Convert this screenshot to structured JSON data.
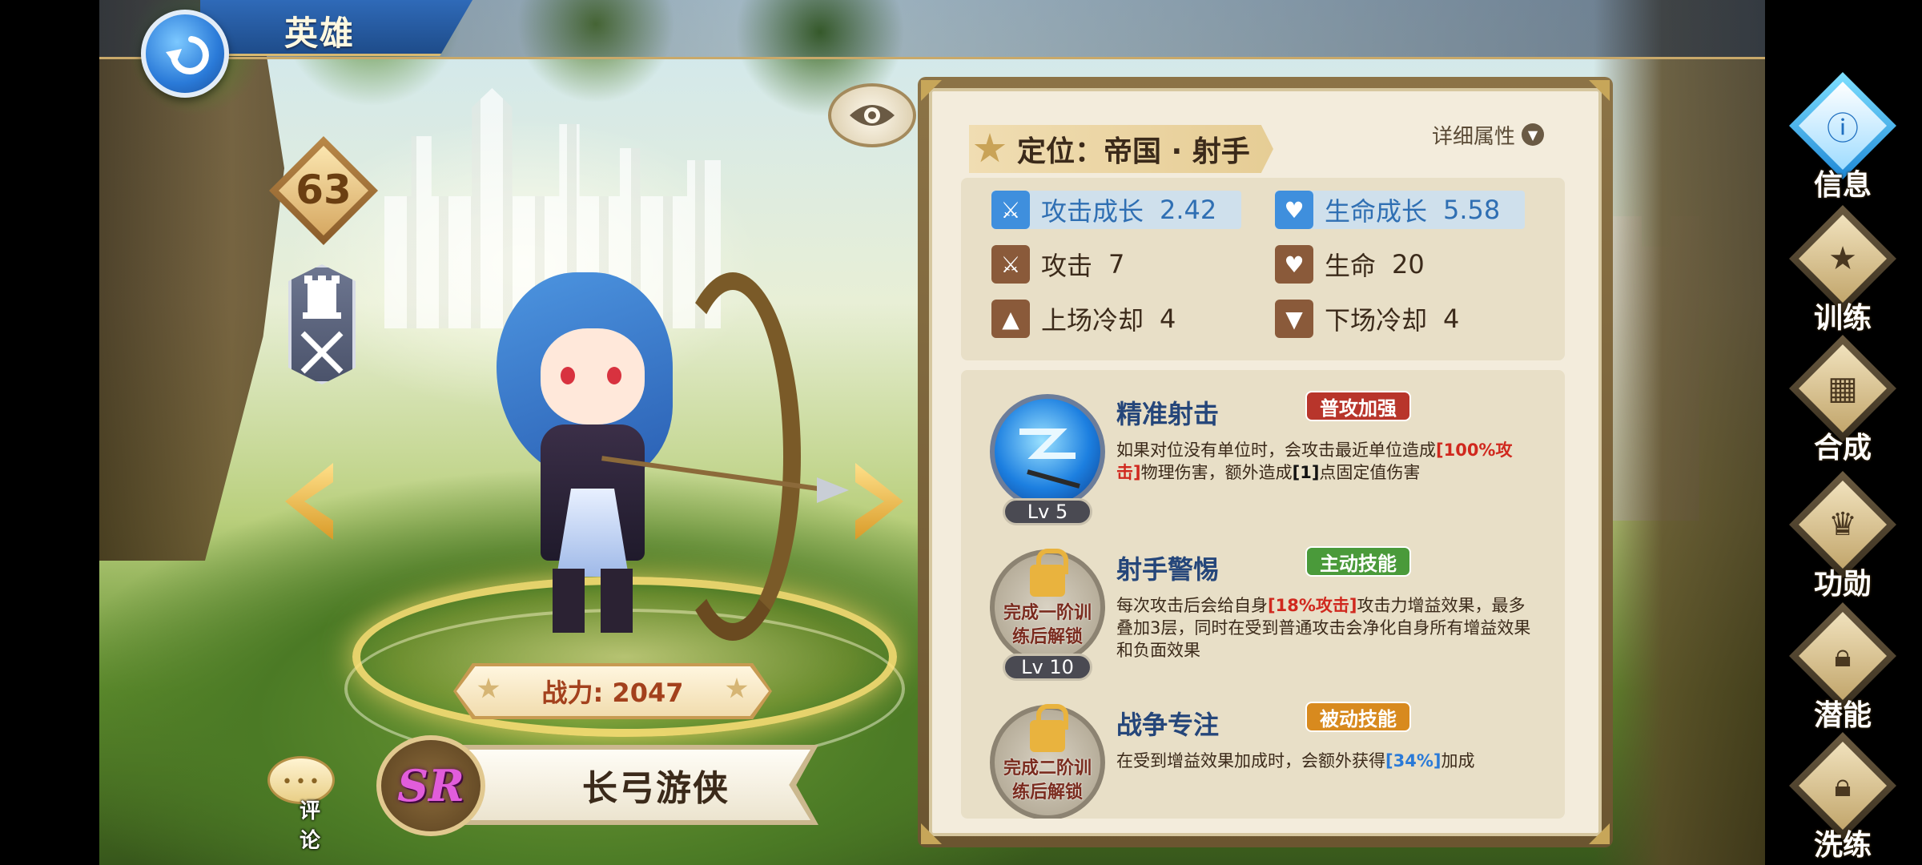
{
  "header": {
    "title": "英雄"
  },
  "hero": {
    "level": "63",
    "power": "战力: 2047",
    "rarity": "SR",
    "name": "长弓游侠",
    "comment_label": "评论"
  },
  "panel": {
    "role": "定位：帝国 · 射手",
    "detail_label": "详细属性",
    "stats": [
      {
        "label": "攻击成长",
        "value": "2.42",
        "icon": "sword-icon"
      },
      {
        "label": "生命成长",
        "value": "5.58",
        "icon": "heart-icon"
      },
      {
        "label": "攻击",
        "value": "7",
        "icon": "sword-icon"
      },
      {
        "label": "生命",
        "value": "20",
        "icon": "heart-icon"
      },
      {
        "label": "上场冷却",
        "value": "4",
        "icon": "arrow-up-icon"
      },
      {
        "label": "下场冷却",
        "value": "4",
        "icon": "arrow-down-icon"
      }
    ],
    "skills": [
      {
        "name": "精准射击",
        "tag": "普攻加强",
        "level": "Lv 5",
        "desc_1": "如果对位没有单位时，会攻击最近单位造成",
        "desc_hl_1": "[100%攻击]",
        "desc_2": "物理伤害，额外造成",
        "desc_hl_2": "[1]",
        "desc_3": "点固定值伤害"
      },
      {
        "name": "射手警惕",
        "tag": "主动技能",
        "level": "Lv 10",
        "unlock": "完成一阶训练后解锁",
        "desc_1": "每次攻击后会给自身",
        "desc_hl_1": "[18%攻击]",
        "desc_2": "攻击力增益效果，最多叠加3层，同时在受到普通攻击会净化自身所有增益效果和负面效果"
      },
      {
        "name": "战争专注",
        "tag": "被动技能",
        "unlock": "完成二阶训练后解锁",
        "desc_1": "在受到增益效果加成时，会额外获得",
        "desc_hl_1": "[34%]",
        "desc_2": "加成"
      }
    ]
  },
  "menu": [
    {
      "label": "信息",
      "icon": "info-icon",
      "active": true
    },
    {
      "label": "训练",
      "icon": "training-icon"
    },
    {
      "label": "合成",
      "icon": "cards-icon"
    },
    {
      "label": "功勋",
      "icon": "crown-icon"
    },
    {
      "label": "潜能",
      "icon": "lock-icon"
    },
    {
      "label": "洗练",
      "icon": "lock-icon"
    }
  ],
  "colors": {
    "accent_gold": "#c9a96a",
    "tag_red": "#b8352b",
    "tag_green": "#4a9a3a",
    "tag_orange": "#d88a1e",
    "highlight_blue": "#2a7ad8",
    "highlight_red": "#d0281e"
  }
}
